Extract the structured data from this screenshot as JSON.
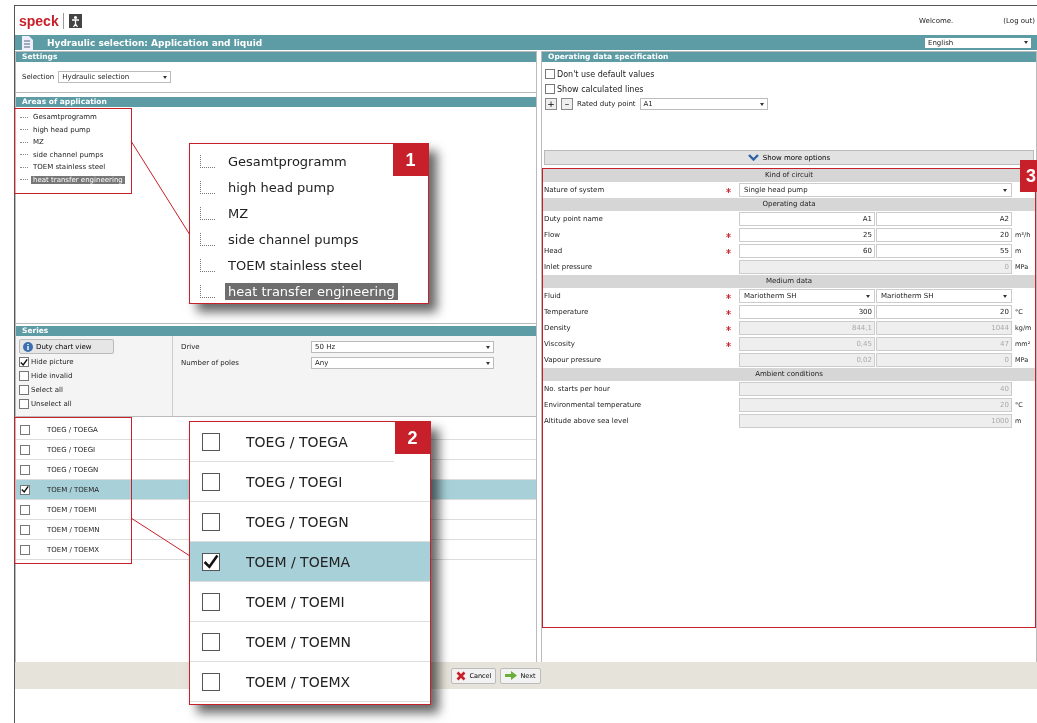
{
  "header": {
    "logo": "speck",
    "welcome": "Welcome.",
    "logout": "(Log out)"
  },
  "title_bar": {
    "title": "Hydraulic selection: Application and liquid",
    "language": "English"
  },
  "settings": {
    "heading": "Settings",
    "label": "Selection",
    "value": "Hydraulic selection"
  },
  "areas": {
    "heading": "Areas of application",
    "items": [
      {
        "label": "Gesamtprogramm",
        "selected": false
      },
      {
        "label": "high head pump",
        "selected": false
      },
      {
        "label": "MZ",
        "selected": false
      },
      {
        "label": "side channel pumps",
        "selected": false
      },
      {
        "label": "TOEM stainless steel",
        "selected": false
      },
      {
        "label": "heat transfer engineering",
        "selected": true
      }
    ]
  },
  "series": {
    "heading": "Series",
    "button": "Duty chart view",
    "options": [
      {
        "label": "Hide picture",
        "checked": true
      },
      {
        "label": "Hide invalid",
        "checked": false
      },
      {
        "label": "Select all",
        "checked": false
      },
      {
        "label": "Unselect all",
        "checked": false
      }
    ],
    "filters": [
      {
        "label": "Drive",
        "value": "50 Hz"
      },
      {
        "label": "Number of poles",
        "value": "Any"
      }
    ],
    "rows": [
      {
        "label": "TOEG / TOEGA",
        "checked": false,
        "selected": false
      },
      {
        "label": "TOEG / TOEGI",
        "checked": false,
        "selected": false
      },
      {
        "label": "TOEG / TOEGN",
        "checked": false,
        "selected": false
      },
      {
        "label": "TOEM / TOEMA",
        "checked": true,
        "selected": true
      },
      {
        "label": "TOEM / TOEMI",
        "checked": false,
        "selected": false
      },
      {
        "label": "TOEM / TOEMN",
        "checked": false,
        "selected": false
      },
      {
        "label": "TOEM / TOEMX",
        "checked": false,
        "selected": false
      }
    ]
  },
  "operating": {
    "heading": "Operating data specification",
    "options": [
      {
        "label": "Don't use default values",
        "checked": false
      },
      {
        "label": "Show calculated lines",
        "checked": false
      }
    ],
    "add": "+",
    "remove": "–",
    "rated_label": "Rated duty point",
    "rated_value": "A1",
    "more": "Show more options",
    "sections": [
      {
        "title": "Kind of circuit",
        "rows": [
          {
            "label": "Nature of system",
            "required": true,
            "kind": "select",
            "values": [
              "Single head pump"
            ]
          }
        ]
      },
      {
        "title": "Operating data",
        "rows": [
          {
            "label": "Duty point name",
            "required": false,
            "kind": "pair",
            "disabled": false,
            "values": [
              "A1",
              "A2"
            ]
          },
          {
            "label": "Flow",
            "required": true,
            "kind": "pair",
            "disabled": false,
            "values": [
              "25",
              "20"
            ],
            "unit": "m³/h"
          },
          {
            "label": "Head",
            "required": true,
            "kind": "pair",
            "disabled": false,
            "values": [
              "60",
              "55"
            ],
            "unit": "m"
          },
          {
            "label": "Inlet pressure",
            "required": false,
            "kind": "wide",
            "disabled": true,
            "values": [
              "0"
            ],
            "unit": "MPa"
          }
        ]
      },
      {
        "title": "Medium data",
        "rows": [
          {
            "label": "Fluid",
            "required": true,
            "kind": "select-pair",
            "values": [
              "Mariotherm SH",
              "Mariotherm SH"
            ]
          },
          {
            "label": "Temperature",
            "required": true,
            "kind": "pair",
            "disabled": false,
            "values": [
              "300",
              "20"
            ],
            "unit": "°C"
          },
          {
            "label": "Density",
            "required": true,
            "kind": "pair",
            "disabled": true,
            "values": [
              "844,1",
              "1044"
            ],
            "unit": "kg/m"
          },
          {
            "label": "Viscosity",
            "required": true,
            "kind": "pair",
            "disabled": true,
            "values": [
              "0,45",
              "47"
            ],
            "unit": "mm²"
          },
          {
            "label": "Vapour pressure",
            "required": false,
            "kind": "pair",
            "disabled": true,
            "values": [
              "0,02",
              "0"
            ],
            "unit": "MPa"
          }
        ]
      },
      {
        "title": "Ambient conditions",
        "rows": [
          {
            "label": "No. starts per hour",
            "required": false,
            "kind": "wide",
            "disabled": true,
            "values": [
              "40"
            ]
          },
          {
            "label": "Environmental temperature",
            "required": false,
            "kind": "wide",
            "disabled": true,
            "values": [
              "20"
            ],
            "unit": "°C"
          },
          {
            "label": "Altitude above sea level",
            "required": false,
            "kind": "wide",
            "disabled": true,
            "values": [
              "1000"
            ],
            "unit": "m"
          }
        ]
      }
    ]
  },
  "footer": {
    "cancel": "Cancel",
    "next": "Next"
  },
  "callouts": [
    {
      "number": "1",
      "items": [
        {
          "label": "Gesamtprogramm",
          "selected": false
        },
        {
          "label": "high head pump",
          "selected": false
        },
        {
          "label": "MZ",
          "selected": false
        },
        {
          "label": "side channel pumps",
          "selected": false
        },
        {
          "label": "TOEM stainless steel",
          "selected": false
        },
        {
          "label": "heat transfer engineering",
          "selected": true
        }
      ]
    },
    {
      "number": "2",
      "rows": [
        {
          "label": "TOEG / TOEGA",
          "checked": false,
          "selected": false
        },
        {
          "label": "TOEG / TOEGI",
          "checked": false,
          "selected": false
        },
        {
          "label": "TOEG / TOEGN",
          "checked": false,
          "selected": false
        },
        {
          "label": "TOEM / TOEMA",
          "checked": true,
          "selected": true
        },
        {
          "label": "TOEM / TOEMI",
          "checked": false,
          "selected": false
        },
        {
          "label": "TOEM / TOEMN",
          "checked": false,
          "selected": false
        },
        {
          "label": "TOEM / TOEMX",
          "checked": false,
          "selected": false
        }
      ]
    },
    {
      "number": "3"
    }
  ]
}
